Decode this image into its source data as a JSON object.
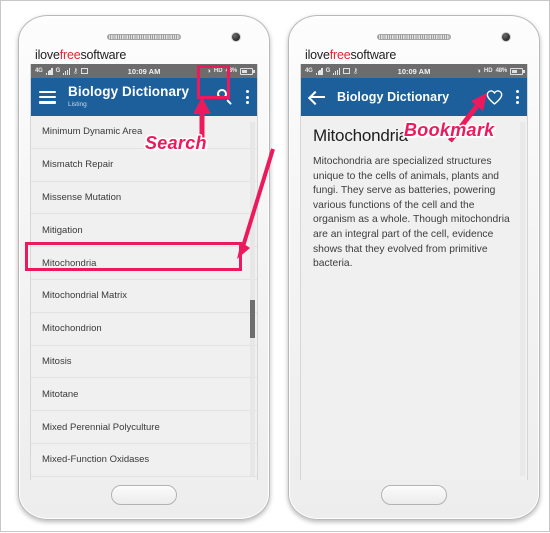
{
  "watermark": {
    "prefix": "ilove",
    "highlight": "free",
    "suffix": "software"
  },
  "status_bar": {
    "network_label": "4G",
    "clock": "10:09 AM",
    "hd_label": "HD",
    "battery_percent": "48%",
    "icons": [
      "signal-bars",
      "signal-bars",
      "usb-icon",
      "screenshot-icon",
      "vibrate-icon",
      "hd-icon",
      "battery-icon"
    ]
  },
  "accent": {
    "pink": "#ec1a5d",
    "header_blue": "#1c5f9b",
    "status_grey": "#6c6c6c"
  },
  "phone_left": {
    "appbar": {
      "menu_icon": "hamburger-icon",
      "title": "Biology Dictionary",
      "subtitle": "Listing",
      "search_icon": "search-icon",
      "overflow_icon": "kebab-menu-icon"
    },
    "list": [
      "Minimum Dynamic Area",
      "Mismatch Repair",
      "Missense Mutation",
      "Mitigation",
      "Mitochondria",
      "Mitochondrial Matrix",
      "Mitochondrion",
      "Mitosis",
      "Mitotane",
      "Mixed Perennial Polyculture",
      "Mixed-Function Oxidases"
    ],
    "selected_item": "Mitochondria"
  },
  "phone_right": {
    "appbar": {
      "back_icon": "back-arrow-icon",
      "title": "Biology Dictionary",
      "bookmark_icon": "heart-bookmark-icon",
      "overflow_icon": "kebab-menu-icon"
    },
    "detail": {
      "heading": "Mitochondria",
      "body": "Mitochondria are specialized structures unique to the cells of animals, plants and fungi. They serve as batteries, powering various functions of the cell and the organism as a whole. Though mitochondria are an integral part of the cell, evidence shows that they evolved from primitive bacteria."
    }
  },
  "annotations": {
    "search_label": "Search",
    "bookmark_label": "Bookmark"
  }
}
